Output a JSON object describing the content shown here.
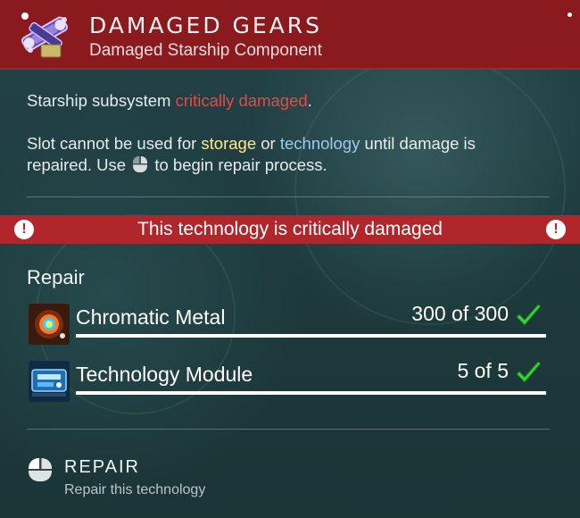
{
  "header": {
    "title": "DAMAGED GEARS",
    "subtitle": "Damaged Starship Component",
    "icon": "damaged-gears-icon",
    "color": "#8a1a1e"
  },
  "description": {
    "line1_prefix": "Starship subsystem ",
    "line1_highlight": "critically damaged",
    "line1_suffix": ".",
    "line2_prefix": "Slot cannot be used for ",
    "line2_storage": "storage",
    "line2_or": " or ",
    "line2_technology": "technology",
    "line2_suffix": " until damage is",
    "line3_prefix": "repaired. Use ",
    "line3_suffix": " to begin repair process."
  },
  "alert": {
    "text": "This technology is critically damaged",
    "icon": "exclamation-icon",
    "color": "#b0262b"
  },
  "repair": {
    "heading": "Repair",
    "items": [
      {
        "name": "Chromatic Metal",
        "count": "300 of 300",
        "icon": "chromatic-metal-icon",
        "complete": true
      },
      {
        "name": "Technology Module",
        "count": "5 of 5",
        "icon": "technology-module-icon",
        "complete": true
      }
    ]
  },
  "action": {
    "label": "REPAIR",
    "sublabel": "Repair this technology",
    "icon": "mouse-icon"
  },
  "colors": {
    "critical": "#e54b45",
    "storage": "#ffe98a",
    "technology": "#9dc9ec",
    "check": "#3ccf3c"
  }
}
